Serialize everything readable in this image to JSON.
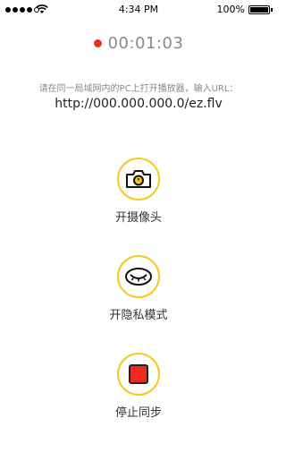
{
  "status_bar": {
    "time": "4:34 PM",
    "battery_percent": "100%",
    "signal_icon": "signal-dots-icon",
    "wifi_icon": "wifi-icon",
    "battery_icon": "battery-icon"
  },
  "recording": {
    "indicator_color": "#e8321e",
    "elapsed": "00:01:03"
  },
  "instruction": {
    "text": "请在同一局域网内的PC上打开播放器，输入URL：",
    "url": "http://000.000.000.0/ez.flv"
  },
  "actions": [
    {
      "label": "开摄像头",
      "icon": "camera-icon"
    },
    {
      "label": "开隐私模式",
      "icon": "eye-closed-icon"
    },
    {
      "label": "停止同步",
      "icon": "stop-icon"
    }
  ],
  "colors": {
    "accent_ring": "#f7c920",
    "stop_red": "#ee2a23"
  }
}
